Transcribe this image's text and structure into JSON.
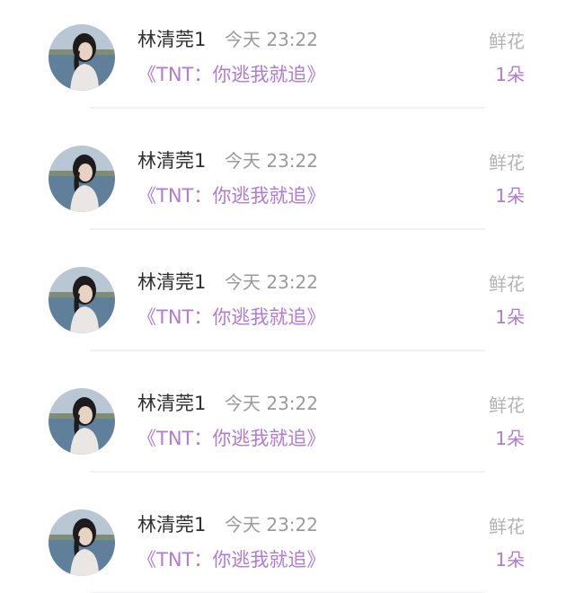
{
  "gifts": [
    {
      "user": "林清莞1",
      "time": "今天 23:22",
      "work": "《TNT：你逃我就追》",
      "gift_label": "鲜花",
      "gift_count": "1朵",
      "avatar_icon": "user-avatar-photo"
    },
    {
      "user": "林清莞1",
      "time": "今天 23:22",
      "work": "《TNT：你逃我就追》",
      "gift_label": "鲜花",
      "gift_count": "1朵",
      "avatar_icon": "user-avatar-photo"
    },
    {
      "user": "林清莞1",
      "time": "今天 23:22",
      "work": "《TNT：你逃我就追》",
      "gift_label": "鲜花",
      "gift_count": "1朵",
      "avatar_icon": "user-avatar-photo"
    },
    {
      "user": "林清莞1",
      "time": "今天 23:22",
      "work": "《TNT：你逃我就追》",
      "gift_label": "鲜花",
      "gift_count": "1朵",
      "avatar_icon": "user-avatar-photo"
    },
    {
      "user": "林清莞1",
      "time": "今天 23:22",
      "work": "《TNT：你逃我就追》",
      "gift_label": "鲜花",
      "gift_count": "1朵",
      "avatar_icon": "user-avatar-photo"
    }
  ],
  "colors": {
    "accent": "#b07ad6",
    "name": "#2f2f2f",
    "muted": "#9a9a9a"
  }
}
